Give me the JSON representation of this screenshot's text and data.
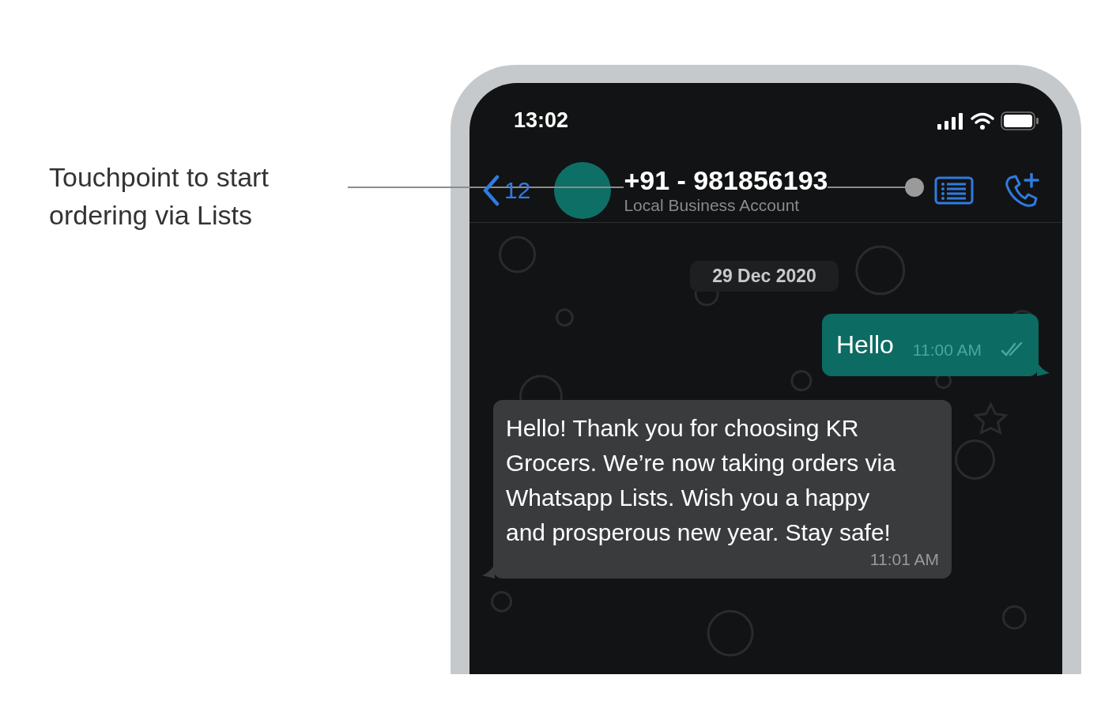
{
  "annotation": {
    "text": "Touchpoint to start ordering via Lists"
  },
  "status_bar": {
    "time": "13:02"
  },
  "header": {
    "back_count": "12",
    "contact_name": "+91 - 981856193",
    "subtitle": "Local Business Account"
  },
  "date_chip": "29 Dec 2020",
  "messages": [
    {
      "kind": "outgoing",
      "text": "Hello",
      "time": "11:00 AM"
    },
    {
      "kind": "incoming",
      "text": "Hello! Thank you for choosing KR Grocers. We’re now taking orders via Whatsapp Lists. Wish you a happy and prosperous new year. Stay safe!",
      "time": "11:01 AM"
    }
  ]
}
